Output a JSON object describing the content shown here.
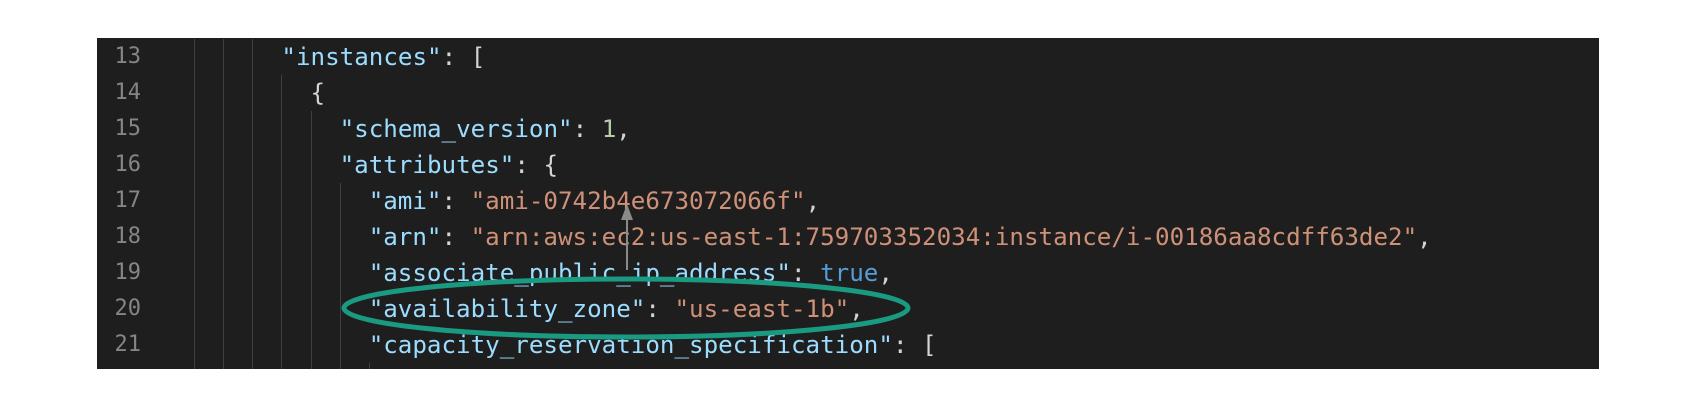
{
  "editor": {
    "colors": {
      "background": "#1e1e1e",
      "key": "#9cdcfe",
      "string": "#ce9178",
      "number": "#b5cea8",
      "keyword": "#569cd6",
      "punctuation": "#d4d4d4",
      "line_number": "#858585"
    },
    "lines": [
      {
        "number": "13",
        "indent": 4,
        "tokens": [
          {
            "type": "key",
            "text": "\"instances\""
          },
          {
            "type": "punc",
            "text": ": ["
          }
        ]
      },
      {
        "number": "14",
        "indent": 5,
        "tokens": [
          {
            "type": "punc",
            "text": "{"
          }
        ]
      },
      {
        "number": "15",
        "indent": 6,
        "tokens": [
          {
            "type": "key",
            "text": "\"schema_version\""
          },
          {
            "type": "punc",
            "text": ": "
          },
          {
            "type": "num",
            "text": "1"
          },
          {
            "type": "punc",
            "text": ","
          }
        ]
      },
      {
        "number": "16",
        "indent": 6,
        "tokens": [
          {
            "type": "key",
            "text": "\"attributes\""
          },
          {
            "type": "punc",
            "text": ": {"
          }
        ]
      },
      {
        "number": "17",
        "indent": 7,
        "tokens": [
          {
            "type": "key",
            "text": "\"ami\""
          },
          {
            "type": "punc",
            "text": ": "
          },
          {
            "type": "str",
            "text": "\"ami-0742b4e673072066f\""
          },
          {
            "type": "punc",
            "text": ","
          }
        ]
      },
      {
        "number": "18",
        "indent": 7,
        "tokens": [
          {
            "type": "key",
            "text": "\"arn\""
          },
          {
            "type": "punc",
            "text": ": "
          },
          {
            "type": "str",
            "text": "\"arn:aws:ec2:us-east-1:759703352034:instance/i-00186aa8cdff63de2\""
          },
          {
            "type": "punc",
            "text": ","
          }
        ]
      },
      {
        "number": "19",
        "indent": 7,
        "tokens": [
          {
            "type": "key",
            "text": "\"associate_public_ip_address\""
          },
          {
            "type": "punc",
            "text": ": "
          },
          {
            "type": "kw",
            "text": "true"
          },
          {
            "type": "punc",
            "text": ","
          }
        ]
      },
      {
        "number": "20",
        "indent": 7,
        "tokens": [
          {
            "type": "key",
            "text": "\"availability_zone\""
          },
          {
            "type": "punc",
            "text": ": "
          },
          {
            "type": "str",
            "text": "\"us-east-1b\""
          },
          {
            "type": "punc",
            "text": ","
          }
        ]
      },
      {
        "number": "21",
        "indent": 7,
        "tokens": [
          {
            "type": "key",
            "text": "\"capacity_reservation_specification\""
          },
          {
            "type": "punc",
            "text": ": ["
          }
        ]
      },
      {
        "number": "",
        "indent": 8,
        "tokens": []
      }
    ]
  },
  "annotation": {
    "ellipse_color": "#1a9a80",
    "arrow_color": "#8a8a8a",
    "highlighted_line": "20"
  }
}
